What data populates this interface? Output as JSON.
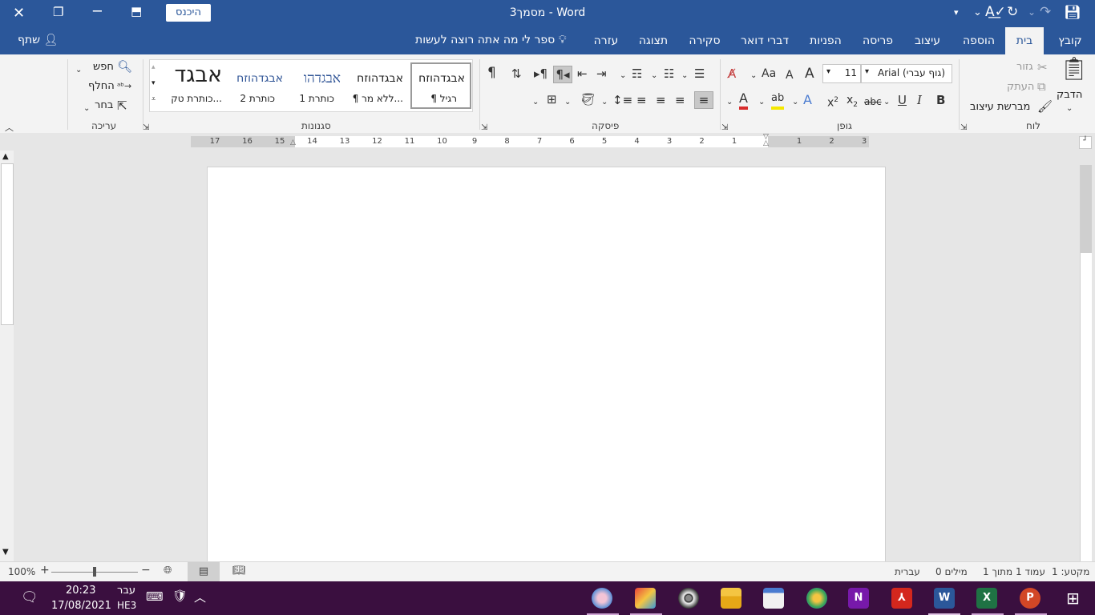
{
  "window": {
    "title": "מסמך3 - Word",
    "signin_label": "היכנס"
  },
  "tabs": [
    {
      "label": "קובץ"
    },
    {
      "label": "בית"
    },
    {
      "label": "הוספה"
    },
    {
      "label": "עיצוב"
    },
    {
      "label": "פריסה"
    },
    {
      "label": "הפניות"
    },
    {
      "label": "דברי דואר"
    },
    {
      "label": "סקירה"
    },
    {
      "label": "תצוגה"
    },
    {
      "label": "עזרה"
    }
  ],
  "tell_me": "ספר לי מה אתה רוצה לעשות",
  "share_label": "שתף",
  "ribbon": {
    "clipboard": {
      "group": "לוח",
      "paste": "הדבק",
      "cut": "גזור",
      "copy": "העתק",
      "format_painter": "מברשת עיצוב"
    },
    "font": {
      "group": "גופן",
      "font_name": "Arial (גוף עברי)",
      "font_size": "11",
      "bold": "B",
      "italic": "I",
      "underline": "U",
      "strike": "abc",
      "sub": "x",
      "sup": "x",
      "case": "Aa",
      "grow": "A",
      "shrink": "A"
    },
    "paragraph": {
      "group": "פיסקה",
      "pilcrow": "¶"
    },
    "styles": {
      "group": "סגנונות",
      "items": [
        {
          "preview": "אבגדהוזח",
          "name": "¶ רגיל"
        },
        {
          "preview": "אבגדהוזח",
          "name": "¶ ללא מר..."
        },
        {
          "preview": "אבגדהו",
          "name": "כותרת 1"
        },
        {
          "preview": "אבגדהוזח",
          "name": "כותרת 2"
        },
        {
          "preview": "אבגד",
          "name": "כותרת טק..."
        }
      ]
    },
    "editing": {
      "group": "עריכה",
      "find": "חפש",
      "replace": "החלף",
      "select": "בחר"
    }
  },
  "ruler": {
    "numbers": [
      "3",
      "2",
      "1",
      "",
      "1",
      "2",
      "3",
      "4",
      "5",
      "6",
      "7",
      "8",
      "9",
      "10",
      "11",
      "12",
      "13",
      "14",
      "15",
      "16",
      "17"
    ]
  },
  "status": {
    "section": "מקטע: 1",
    "page": "עמוד 1 מתוך 1",
    "words": "0 מילים",
    "language": "עברית",
    "zoom": "100%",
    "zoom_level": 0.5
  },
  "taskbar": {
    "time": "20:23",
    "date": "17/08/2021",
    "lang": "עבר",
    "lang_code": "HE3"
  },
  "colors": {
    "word_blue": "#2b579a",
    "taskbar": "#3a0f3f"
  }
}
